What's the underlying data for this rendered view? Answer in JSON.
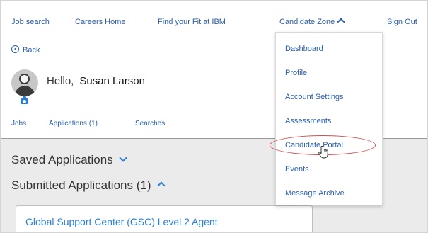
{
  "topnav": {
    "job_search": "Job search",
    "careers_home": "Careers Home",
    "find_fit": "Find your Fit at IBM",
    "candidate_zone": "Candidate Zone",
    "sign_out": "Sign Out"
  },
  "back_label": "Back",
  "greeting": {
    "hello": "Hello,",
    "name": "Susan Larson"
  },
  "tabs": {
    "jobs": "Jobs",
    "applications": "Applications (1)",
    "searches": "Searches"
  },
  "sections": {
    "saved": "Saved Applications",
    "submitted": "Submitted Applications (1)"
  },
  "job_card": {
    "title": "Global Support Center (GSC) Level 2 Agent"
  },
  "dropdown": {
    "items": [
      "Dashboard",
      "Profile",
      "Account Settings",
      "Assessments",
      "Candidate Portal",
      "Events",
      "Message Archive"
    ],
    "highlighted": "Candidate Portal"
  },
  "colors": {
    "link": "#2b5eaa",
    "accent": "#2b7fd6",
    "highlight": "#d44a4a",
    "panel_bg": "#ebebeb"
  },
  "icons": [
    "back-icon",
    "avatar",
    "camera-icon",
    "chevron-up-icon",
    "chevron-down-icon",
    "hand-cursor-icon"
  ]
}
